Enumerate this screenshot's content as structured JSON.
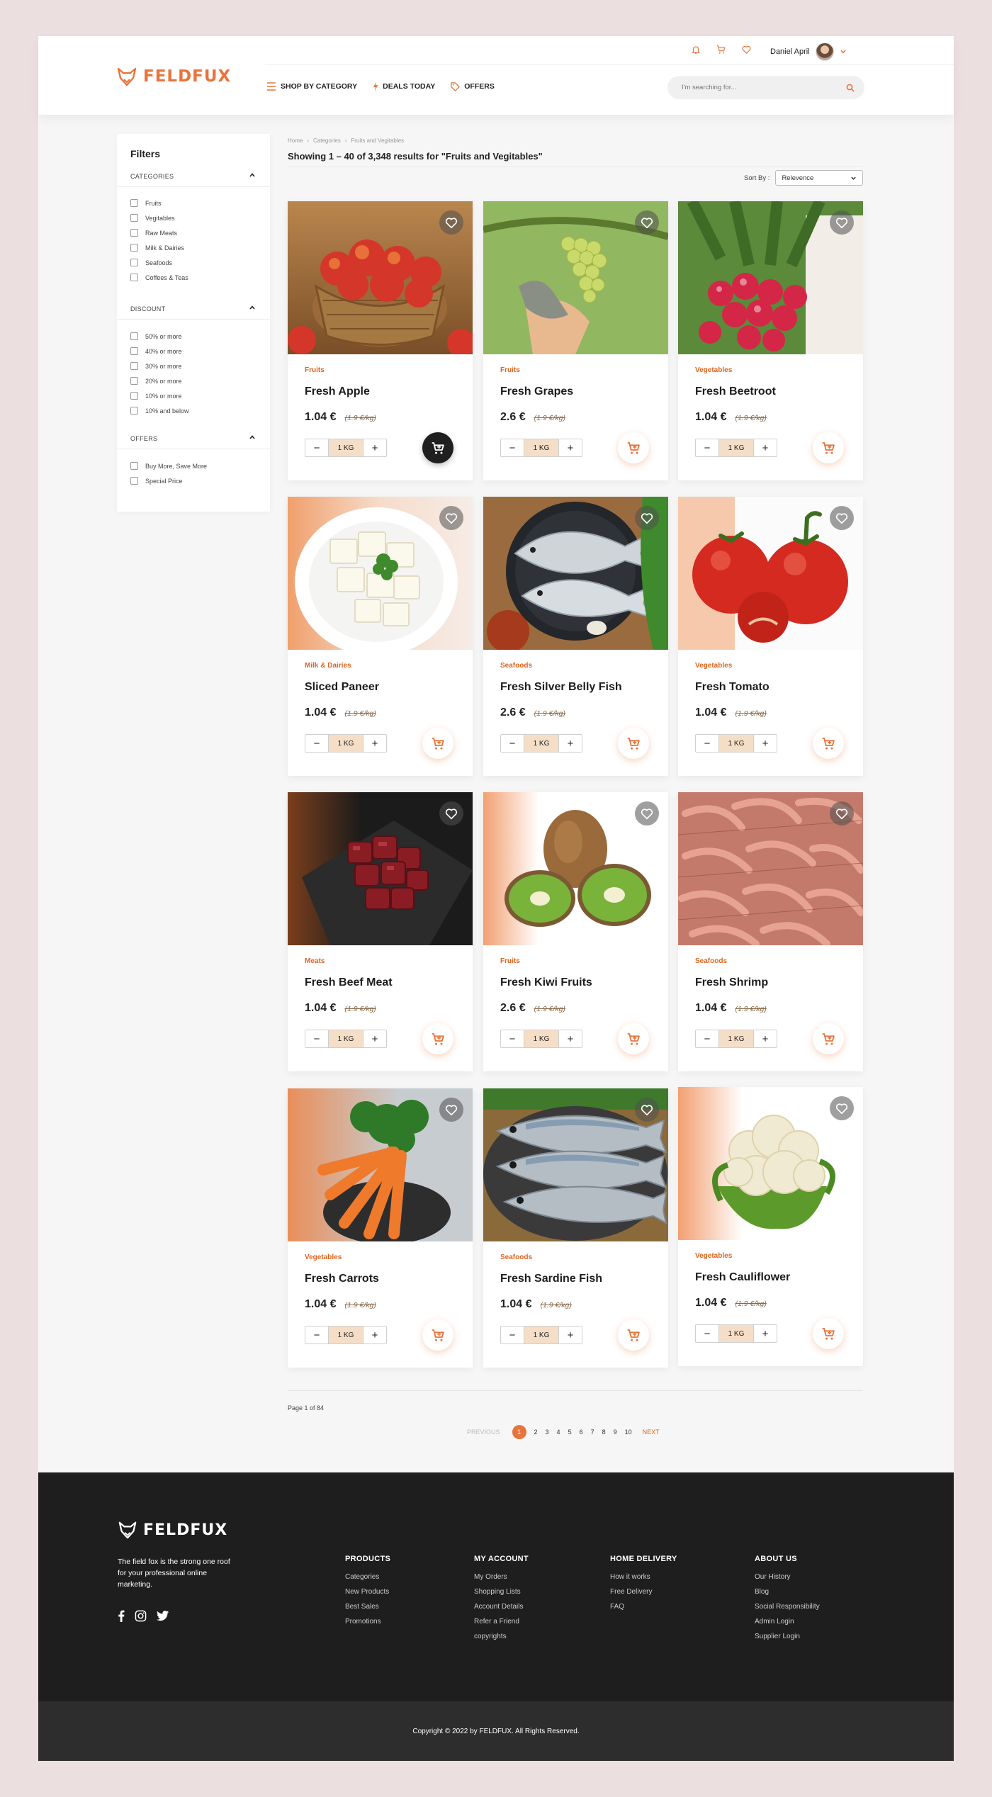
{
  "header": {
    "logo_text": "FELDFUX",
    "user_name": "Daniel April",
    "nav": {
      "shop_by_category": "SHOP BY CATEGORY",
      "deals_today": "DEALS TODAY",
      "offers": "OFFERS"
    },
    "search_placeholder": "I'm searching for..."
  },
  "sidebar": {
    "title": "Filters",
    "categories": {
      "heading": "CATEGORIES",
      "options": [
        "Fruits",
        "Vegitables",
        "Raw Meats",
        "Milk & Dairies",
        "Seafoods",
        "Coffees & Teas"
      ]
    },
    "discount": {
      "heading": "DISCOUNT",
      "options": [
        "50% or more",
        "40% or more",
        "30% or more",
        "20% or more",
        "10% or more",
        "10% and below"
      ]
    },
    "offers": {
      "heading": "OFFERS",
      "options": [
        "Buy More, Save More",
        "Special Price"
      ]
    }
  },
  "breadcrumb": [
    "Home",
    "Categories",
    "Fruits and Vegitables"
  ],
  "results_text": "Showing 1 – 40 of 3,348 results for \"Fruits and Vegitables\"",
  "sort": {
    "label": "Sort By :",
    "value": "Relevence"
  },
  "products": [
    {
      "category": "Fruits",
      "name": "Fresh Apple",
      "price": "1.04 €",
      "old_price": "(1.9 €/kg)",
      "qty": "1 KG",
      "image": "apples-basket"
    },
    {
      "category": "Fruits",
      "name": "Fresh Grapes",
      "price": "2.6 €",
      "old_price": "(1.9 €/kg)",
      "qty": "1 KG",
      "image": "grapes-vine"
    },
    {
      "category": "Vegetables",
      "name": "Fresh Beetroot",
      "price": "1.04 €",
      "old_price": "(1.9 €/kg)",
      "qty": "1 KG",
      "image": "radish-bunch"
    },
    {
      "category": "Milk & Dairies",
      "name": "Sliced Paneer",
      "price": "1.04 €",
      "old_price": "(1.9 €/kg)",
      "qty": "1 KG",
      "image": "paneer-plate"
    },
    {
      "category": "Seafoods",
      "name": "Fresh Silver Belly Fish",
      "price": "2.6 €",
      "old_price": "(1.9 €/kg)",
      "qty": "1 KG",
      "image": "silver-fish-pan"
    },
    {
      "category": "Vegetables",
      "name": "Fresh Tomato",
      "price": "1.04 €",
      "old_price": "(1.9 €/kg)",
      "qty": "1 KG",
      "image": "tomatoes"
    },
    {
      "category": "Meats",
      "name": "Fresh Beef Meat",
      "price": "1.04 €",
      "old_price": "(1.9 €/kg)",
      "qty": "1 KG",
      "image": "beef-cubes"
    },
    {
      "category": "Fruits",
      "name": "Fresh Kiwi Fruits",
      "price": "2.6 €",
      "old_price": "(1.9 €/kg)",
      "qty": "1 KG",
      "image": "kiwi"
    },
    {
      "category": "Seafoods",
      "name": "Fresh Shrimp",
      "price": "1.04 €",
      "old_price": "(1.9 €/kg)",
      "qty": "1 KG",
      "image": "shrimp"
    },
    {
      "category": "Vegetables",
      "name": "Fresh Carrots",
      "price": "1.04 €",
      "old_price": "(1.9 €/kg)",
      "qty": "1 KG",
      "image": "carrots-bowl"
    },
    {
      "category": "Seafoods",
      "name": "Fresh Sardine Fish",
      "price": "1.04 €",
      "old_price": "(1.9 €/kg)",
      "qty": "1 KG",
      "image": "sardines"
    },
    {
      "category": "Vegetables",
      "name": "Fresh Cauliflower",
      "price": "1.04 €",
      "old_price": "(1.9 €/kg)",
      "qty": "1 KG",
      "image": "cauliflower"
    }
  ],
  "pagination": {
    "info": "Page 1 of 84",
    "previous": "PREVIOUS",
    "next": "NEXT",
    "pages": [
      "1",
      "2",
      "3",
      "4",
      "5",
      "6",
      "7",
      "8",
      "9",
      "10"
    ],
    "current": "1"
  },
  "footer": {
    "logo_text": "FELDFUX",
    "tagline": "The field fox is the strong one roof for your professional online marketing.",
    "columns": [
      {
        "title": "PRODUCTS",
        "links": [
          "Categories",
          "New Products",
          "Best Sales",
          "Promotions"
        ]
      },
      {
        "title": "MY ACCOUNT",
        "links": [
          "My Orders",
          "Shopping Lists",
          "Account Details",
          "Refer a Friend",
          "copyrights"
        ]
      },
      {
        "title": "HOME DELIVERY",
        "links": [
          "How it works",
          "Free Delivery",
          "FAQ"
        ]
      },
      {
        "title": "ABOUT US",
        "links": [
          "Our History",
          "Blog",
          "Social Responsibility",
          "Admin Login",
          "Supplier Login"
        ]
      }
    ],
    "copyright": "Copyright © 2022 by FELDFUX. All Rights Reserved."
  },
  "colors": {
    "accent": "#e8743b",
    "category": "#e0641e",
    "footer_bg": "#1e1e1e",
    "qty_bg": "#f5dec7"
  }
}
